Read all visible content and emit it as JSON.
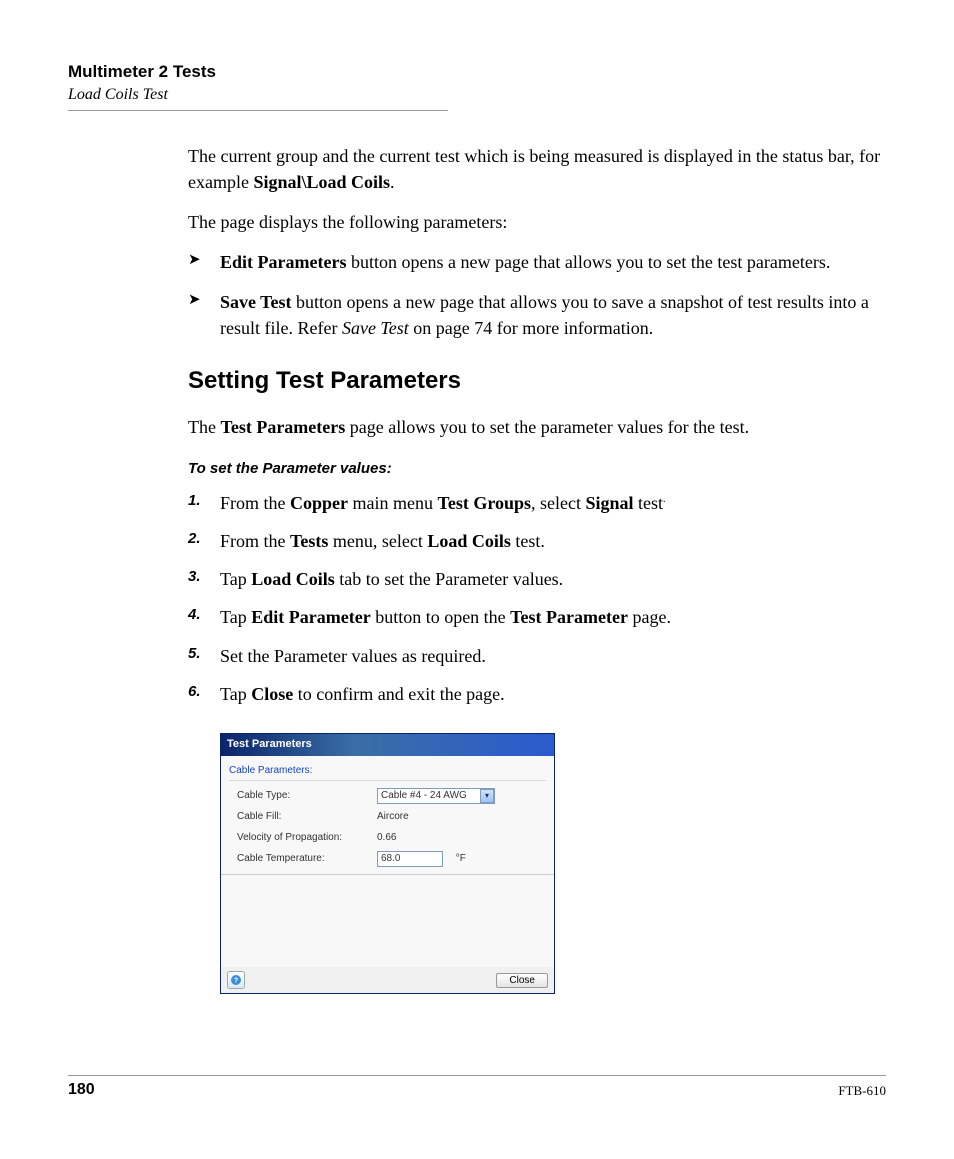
{
  "header": {
    "chapter": "Multimeter 2 Tests",
    "section": "Load Coils Test"
  },
  "intro": {
    "p1_a": "The current group and the current test which is being measured is displayed in the status bar, for example ",
    "p1_b": "Signal\\Load Coils",
    "p1_c": ".",
    "p2": "The page displays the following parameters:"
  },
  "bullets": {
    "b1_strong": "Edit Parameters",
    "b1_rest": " button opens a new page that allows you to set the test parameters.",
    "b2_strong": "Save Test",
    "b2_rest_a": " button opens a new page that allows you to save a snapshot of test results into a result file. Refer ",
    "b2_rest_i": "Save Test",
    "b2_rest_b": " on page 74 for more information."
  },
  "subheading": "Setting Test Parameters",
  "sub_p_a": "The ",
  "sub_p_b": "Test Parameters",
  "sub_p_c": " page allows you to set the parameter values for the test.",
  "procedure_heading": "To set the Parameter values:",
  "steps": {
    "s1": {
      "num": "1.",
      "a": "From the ",
      "b": "Copper",
      "c": " main menu ",
      "d": "Test Groups",
      "e": ", select ",
      "f": "Signal",
      "g": " test"
    },
    "s2": {
      "num": "2.",
      "a": "From the ",
      "b": "Tests",
      "c": " menu, select ",
      "d": "Load Coils",
      "e": " test."
    },
    "s3": {
      "num": "3.",
      "a": "Tap ",
      "b": "Load Coils",
      "c": " tab to set the Parameter values."
    },
    "s4": {
      "num": "4.",
      "a": "Tap ",
      "b": "Edit Parameter",
      "c": " button to open the ",
      "d": "Test Parameter",
      "e": " page."
    },
    "s5": {
      "num": "5.",
      "a": "Set the Parameter values as required."
    },
    "s6": {
      "num": "6.",
      "a": "Tap ",
      "b": "Close",
      "c": " to confirm and exit the page."
    }
  },
  "dialog": {
    "title": "Test Parameters",
    "group": "Cable Parameters:",
    "rows": {
      "r1": {
        "label": "Cable Type:",
        "value": "Cable #4 - 24 AWG"
      },
      "r2": {
        "label": "Cable Fill:",
        "value": "Aircore"
      },
      "r3": {
        "label": "Velocity of Propagation:",
        "value": "0.66"
      },
      "r4": {
        "label": "Cable Temperature:",
        "value": "68.0",
        "unit": "°F"
      }
    },
    "close": "Close"
  },
  "footer": {
    "page": "180",
    "doc": "FTB-610"
  }
}
